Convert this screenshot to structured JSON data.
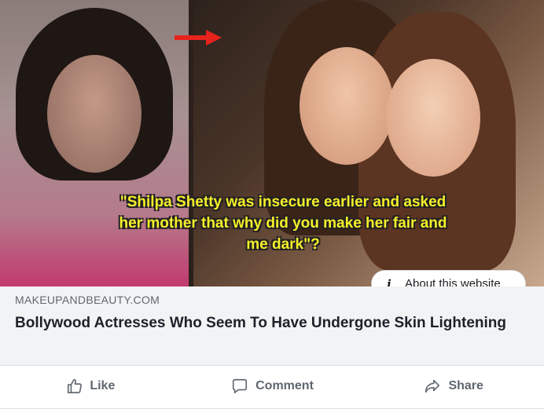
{
  "post": {
    "caption_lines": [
      "\"Shilpa Shetty was insecure earlier and asked",
      "her mother that why did you make her fair and",
      "me dark\"?"
    ],
    "about_label": "About this website",
    "domain": "MAKEUPANDBEAUTY.COM",
    "headline": "Bollywood Actresses Who Seem To Have Undergone Skin Lightening"
  },
  "actions": {
    "like": "Like",
    "comment": "Comment",
    "share": "Share"
  },
  "colors": {
    "caption": "#f5ef2a",
    "arrow": "#e8221c",
    "meta_bg": "#f2f3f5",
    "action_text": "#606770"
  },
  "icons": [
    "thumbs-up-icon",
    "comment-bubble-icon",
    "share-arrow-icon",
    "info-icon",
    "red-arrow-icon"
  ]
}
